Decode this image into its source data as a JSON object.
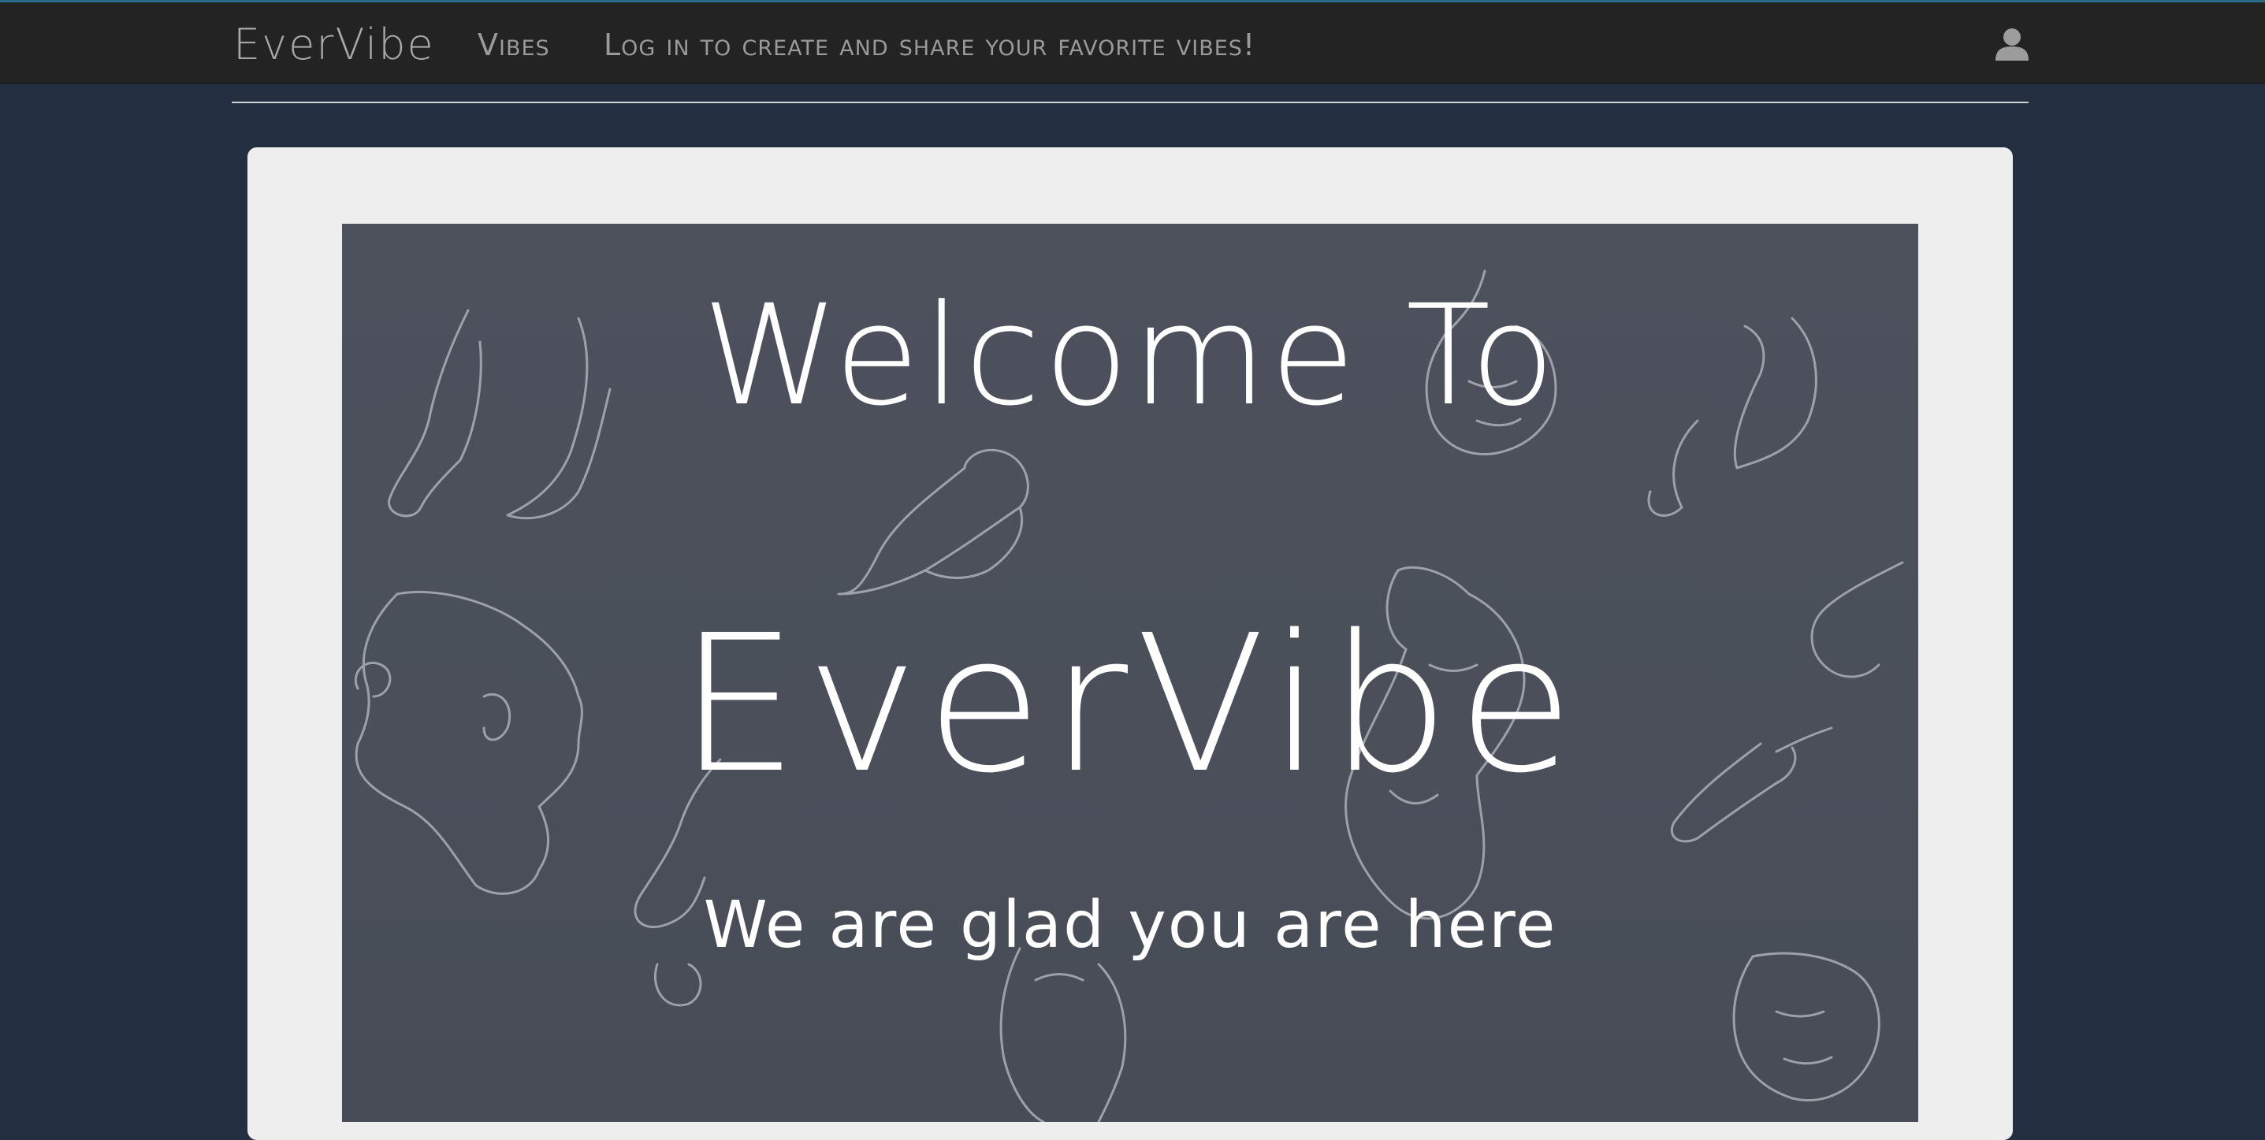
{
  "navbar": {
    "brand": "EverVibe",
    "vibes_link": "Vibes",
    "login_message": "Log in to create and share your favorite vibes!",
    "user_icon": "user-icon"
  },
  "hero": {
    "welcome_text": "Welcome To",
    "logo_text": "EverVibe",
    "tagline": "We are glad you are here",
    "background_art": "line-art-figures"
  },
  "colors": {
    "page_background": "#232f41",
    "navbar_background": "#232323",
    "card_background": "#eeeeee",
    "hero_background": "#4b505b",
    "hero_text": "#ffffff"
  }
}
